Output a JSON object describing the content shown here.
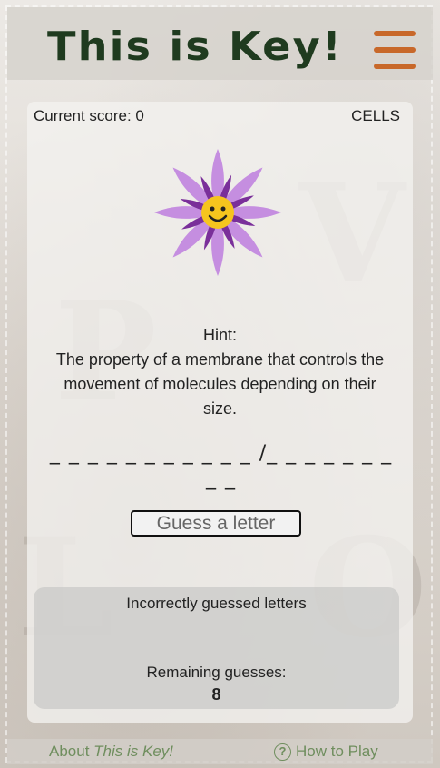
{
  "header": {
    "title": "This is Key!",
    "menu_icon": "hamburger-menu-icon",
    "accent_color": "#c8682a",
    "title_color": "#1f3b1f"
  },
  "game": {
    "score_text": "Current score: 0",
    "topic": "CELLS",
    "flower_icon": "smiling-flower-icon",
    "hint_label": "Hint:",
    "hint_text": "The property of a membrane that controls the movement of molecules depending on their size.",
    "word_pattern": "_ _ _ _ _ _ _ _ _ _ _ /_ _ _ _ _ _ _ _ _",
    "guess_button": "Guess a letter",
    "incorrect_label": "Incorrectly guessed letters",
    "remaining_label": "Remaining guesses:",
    "remaining_count": "8"
  },
  "footer": {
    "about_prefix": "About ",
    "about_italic": "This is Key!",
    "help_icon": "question-circle-icon",
    "how_to_play": "How to Play",
    "link_color": "#6f8e5e"
  }
}
